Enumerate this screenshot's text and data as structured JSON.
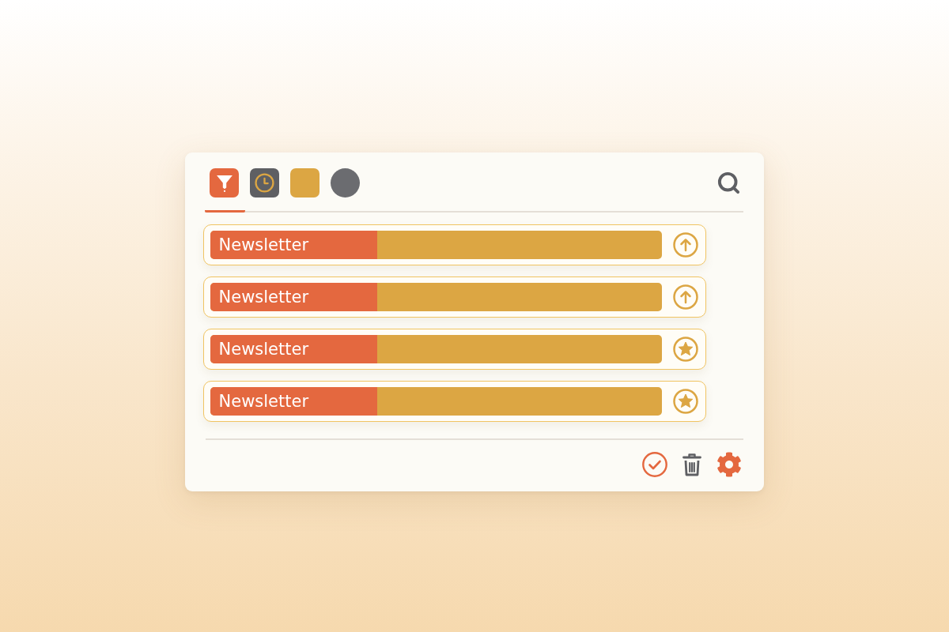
{
  "tabs": [
    {
      "kind": "filter",
      "selected": true
    },
    {
      "kind": "clock",
      "selected": false
    },
    {
      "kind": "square",
      "selected": false
    },
    {
      "kind": "circle",
      "selected": false
    }
  ],
  "rows": [
    {
      "label": "Newsletter",
      "level": 0.37,
      "kind": "upload"
    },
    {
      "label": "Newsletter",
      "level": 0.37,
      "kind": "upload"
    },
    {
      "label": "Newsletter",
      "level": 0.37,
      "kind": "star"
    },
    {
      "label": "Newsletter",
      "level": 0.37,
      "kind": "star"
    }
  ],
  "footer_actions": [
    {
      "kind": "confirm"
    },
    {
      "kind": "delete"
    },
    {
      "kind": "settings"
    }
  ]
}
